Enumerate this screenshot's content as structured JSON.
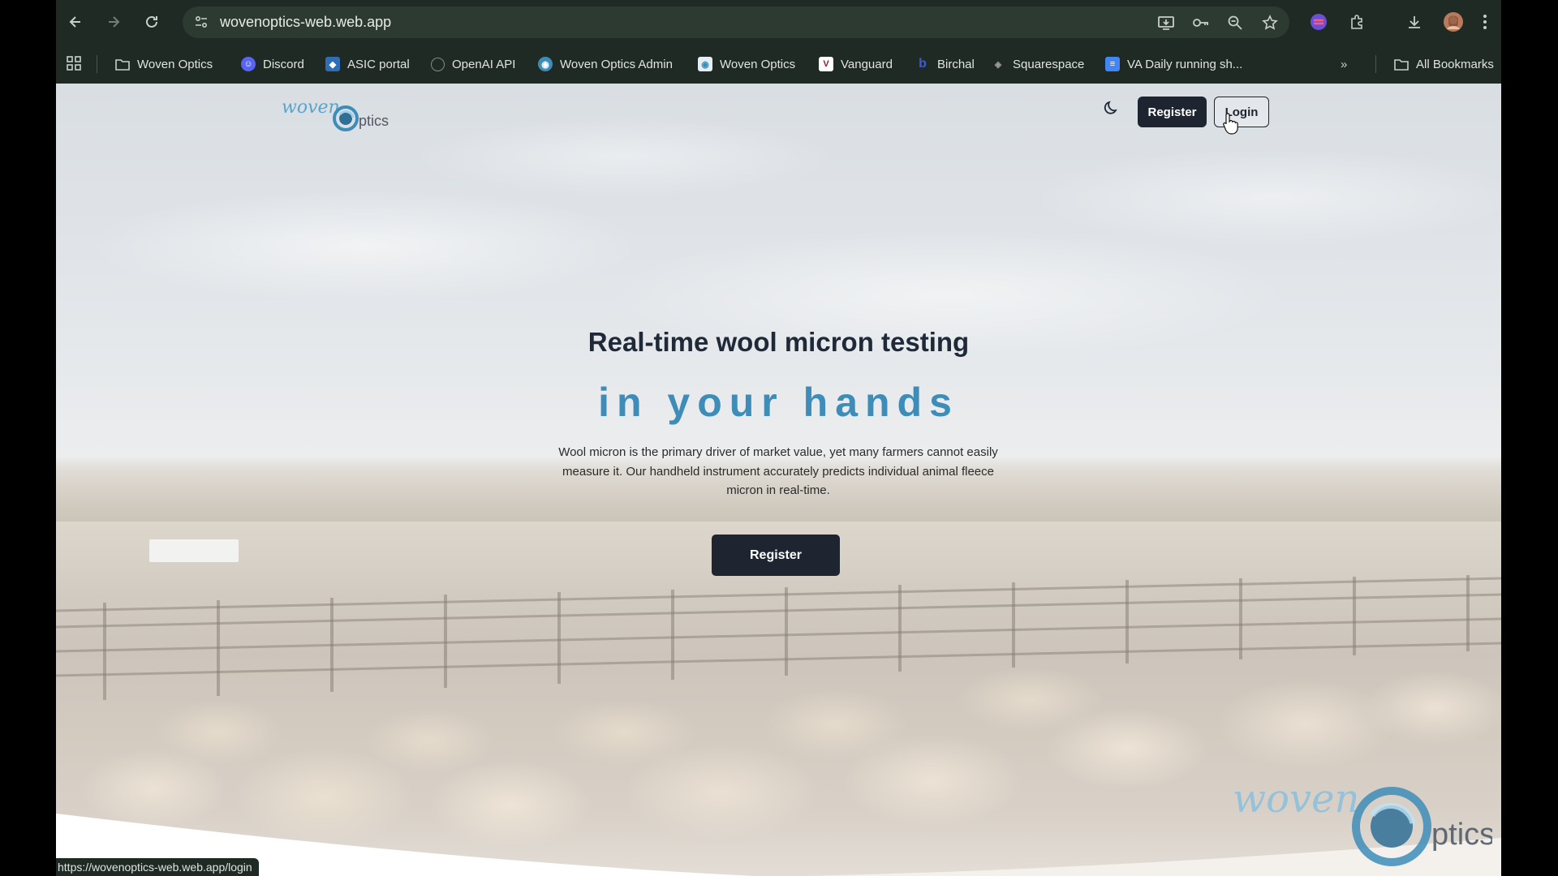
{
  "browser": {
    "url": "wovenoptics-web.web.app",
    "status_url": "https://wovenoptics-web.web.app/login",
    "bookmarks": [
      {
        "label": "Woven Optics",
        "icon": "folder-icon"
      },
      {
        "label": "Discord",
        "icon": "discord-icon",
        "color": "#5865f2"
      },
      {
        "label": "ASIC portal",
        "icon": "asic-icon",
        "color": "#2f6db5"
      },
      {
        "label": "OpenAI API",
        "icon": "openai-icon",
        "color": "#888888"
      },
      {
        "label": "Woven Optics Admin",
        "icon": "woven-optics-icon",
        "color": "#3d8db8"
      },
      {
        "label": "Woven Optics",
        "icon": "woven-optics-icon",
        "color": "#3d8db8"
      },
      {
        "label": "Vanguard",
        "icon": "vanguard-icon",
        "color": "#9b1b1b",
        "glyph": "V"
      },
      {
        "label": "Birchal",
        "icon": "birchal-icon",
        "color": "#3b5bdb",
        "glyph": "b"
      },
      {
        "label": "Squarespace",
        "icon": "squarespace-icon",
        "color": "#777777"
      },
      {
        "label": "VA Daily running sh...",
        "icon": "google-docs-icon",
        "color": "#4285f4"
      }
    ],
    "all_bookmarks_label": "All Bookmarks"
  },
  "page": {
    "nav": {
      "register_label": "Register",
      "login_label": "Login",
      "theme_icon": "moon-icon"
    },
    "logo_text": {
      "part1": "woven",
      "part2": "ptics"
    },
    "hero": {
      "title": "Real-time wool micron testing",
      "subtitle": "in your hands",
      "description": "Wool micron is the primary driver of market value, yet many farmers cannot easily measure it. Our handheld instrument accurately predicts individual animal fleece micron in real-time.",
      "cta_label": "Register"
    },
    "colors": {
      "accent": "#3d8db8",
      "button_dark": "#1e2430"
    }
  }
}
